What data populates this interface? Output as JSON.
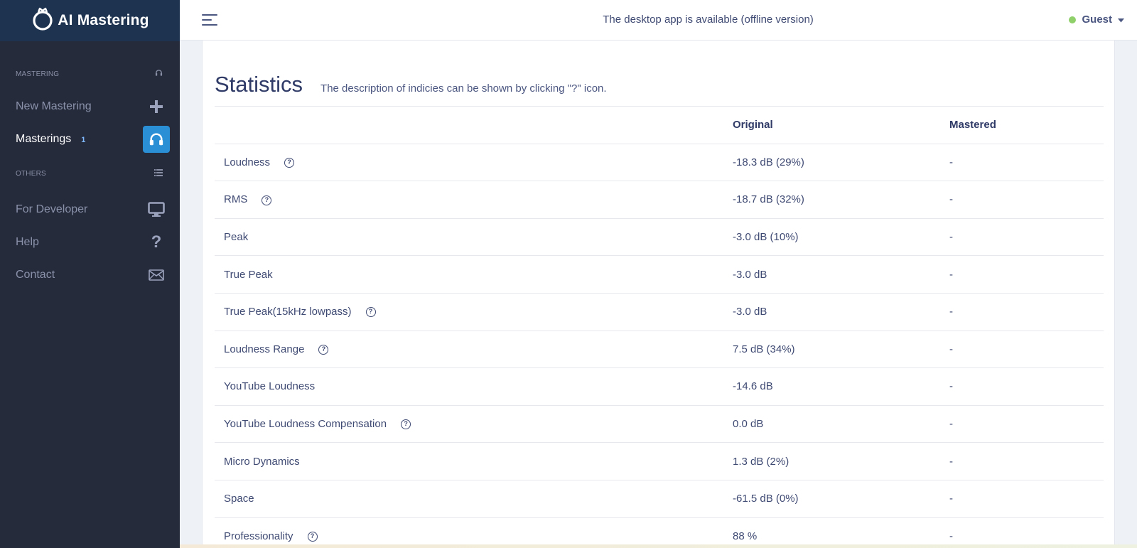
{
  "brand": {
    "name": "AI Mastering"
  },
  "sidebar": {
    "sections": [
      {
        "header": "MASTERING",
        "header_icon": "headphones-icon",
        "items": [
          {
            "label": "New Mastering",
            "icon": "plus-icon",
            "count": ""
          },
          {
            "label": "Masterings",
            "icon": "headphones-icon",
            "count": "1",
            "active": true
          }
        ]
      },
      {
        "header": "OTHERS",
        "header_icon": "list-icon",
        "items": [
          {
            "label": "For Developer",
            "icon": "monitor-icon"
          },
          {
            "label": "Help",
            "icon": "question-icon"
          },
          {
            "label": "Contact",
            "icon": "envelope-icon"
          }
        ]
      }
    ]
  },
  "topbar": {
    "notice": "The desktop app is available (offline version)",
    "user": "Guest",
    "status_color": "#8fd06a"
  },
  "stats": {
    "title": "Statistics",
    "description": "The description of indicies can be shown by clicking \"?\" icon.",
    "columns": [
      "",
      "Original",
      "Mastered"
    ],
    "help_glyph": "?",
    "rows": [
      {
        "label": "Loudness",
        "help": true,
        "original": "-18.3 dB (29%)",
        "mastered": "-"
      },
      {
        "label": "RMS",
        "help": true,
        "original": "-18.7 dB (32%)",
        "mastered": "-"
      },
      {
        "label": "Peak",
        "help": false,
        "original": "-3.0 dB (10%)",
        "mastered": "-"
      },
      {
        "label": "True Peak",
        "help": false,
        "original": "-3.0 dB",
        "mastered": "-"
      },
      {
        "label": "True Peak(15kHz lowpass)",
        "help": true,
        "original": "-3.0 dB",
        "mastered": "-"
      },
      {
        "label": "Loudness Range",
        "help": true,
        "original": "7.5 dB (34%)",
        "mastered": "-"
      },
      {
        "label": "YouTube Loudness",
        "help": false,
        "original": "-14.6 dB",
        "mastered": "-"
      },
      {
        "label": "YouTube Loudness Compensation",
        "help": true,
        "original": "0.0 dB",
        "mastered": "-"
      },
      {
        "label": "Micro Dynamics",
        "help": false,
        "original": "1.3 dB (2%)",
        "mastered": "-"
      },
      {
        "label": "Space",
        "help": false,
        "original": "-61.5 dB (0%)",
        "mastered": "-"
      },
      {
        "label": "Professionality",
        "help": true,
        "original": "88 %",
        "mastered": "-"
      }
    ]
  }
}
